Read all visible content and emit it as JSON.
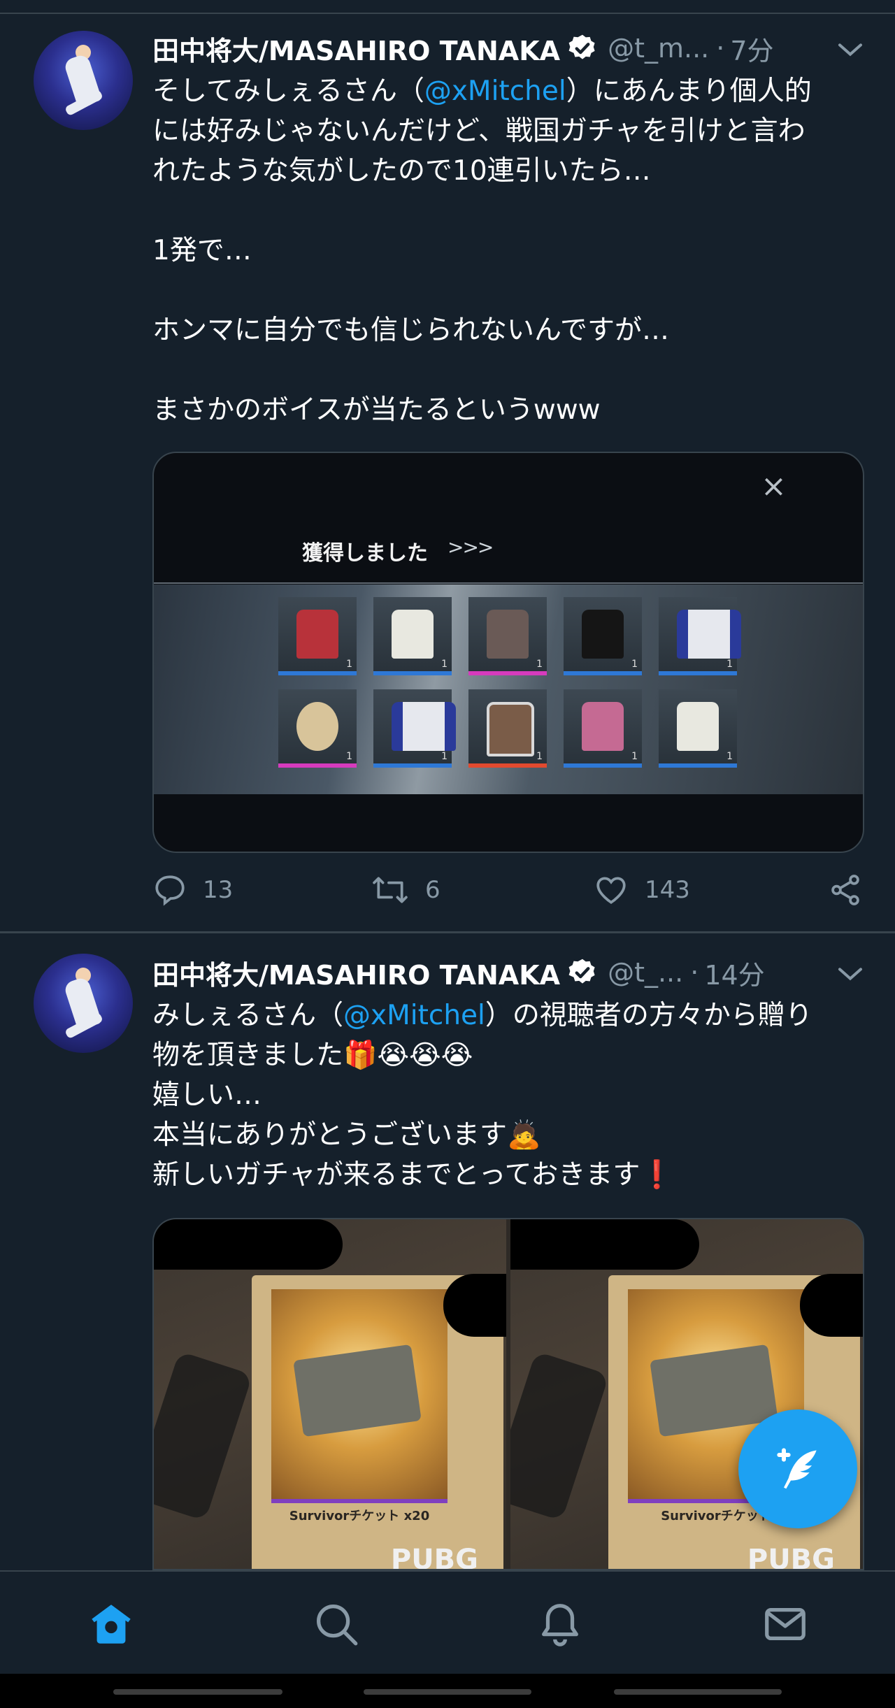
{
  "tweets": [
    {
      "name": "田中将大/MASAHIRO TANAKA",
      "handle": "@t_m...",
      "separator": "·",
      "time": "7分",
      "text": [
        [
          "そしてみしぇるさん（",
          "@xMitchel",
          "）にあんまり個人的"
        ],
        [
          "には好みじゃないんだけど、戦国ガチャを引けと言わ"
        ],
        [
          "れたような気がしたので10連引いたら…"
        ],
        [],
        [
          "1発で…"
        ],
        [],
        [
          "ホンマに自分でも信じられないんですが…"
        ],
        [],
        [
          "まさかのボイスが当たるというwww"
        ]
      ],
      "media_title": "獲得しました",
      "media_arrows": ">>>",
      "media_close": "×",
      "counts": {
        "reply": "13",
        "retweet": "6",
        "like": "143"
      }
    },
    {
      "name": "田中将大/MASAHIRO TANAKA",
      "handle": "@t_...",
      "separator": "·",
      "time": "14分",
      "line1_a": "みしぇるさん（",
      "line1_mention": "@xMitchel",
      "line1_b": "）の視聴者の方々から贈り",
      "line2": "物を頂きました🎁😭😭😭",
      "line3": "嬉しい…",
      "line4": "本当にありがとうございます🙇",
      "line5": "新しいガチャが来るまでとっておきます❗",
      "media_label_left": "Survivorチケット x20",
      "media_label_right": "Survivorチケット",
      "media_brand": "PUBG"
    }
  ],
  "icons": {
    "verified": "verified-badge-icon",
    "chevron": "chevron-down-icon",
    "reply": "reply-icon",
    "retweet": "retweet-icon",
    "like": "heart-icon",
    "share": "share-icon",
    "compose": "compose-tweet-icon",
    "home": "home-icon",
    "search": "search-icon",
    "notifications": "bell-icon",
    "messages": "mail-icon"
  },
  "colors": {
    "background": "#15202b",
    "accent": "#1da1f2",
    "muted": "#8899a6",
    "divider": "#38444d"
  }
}
